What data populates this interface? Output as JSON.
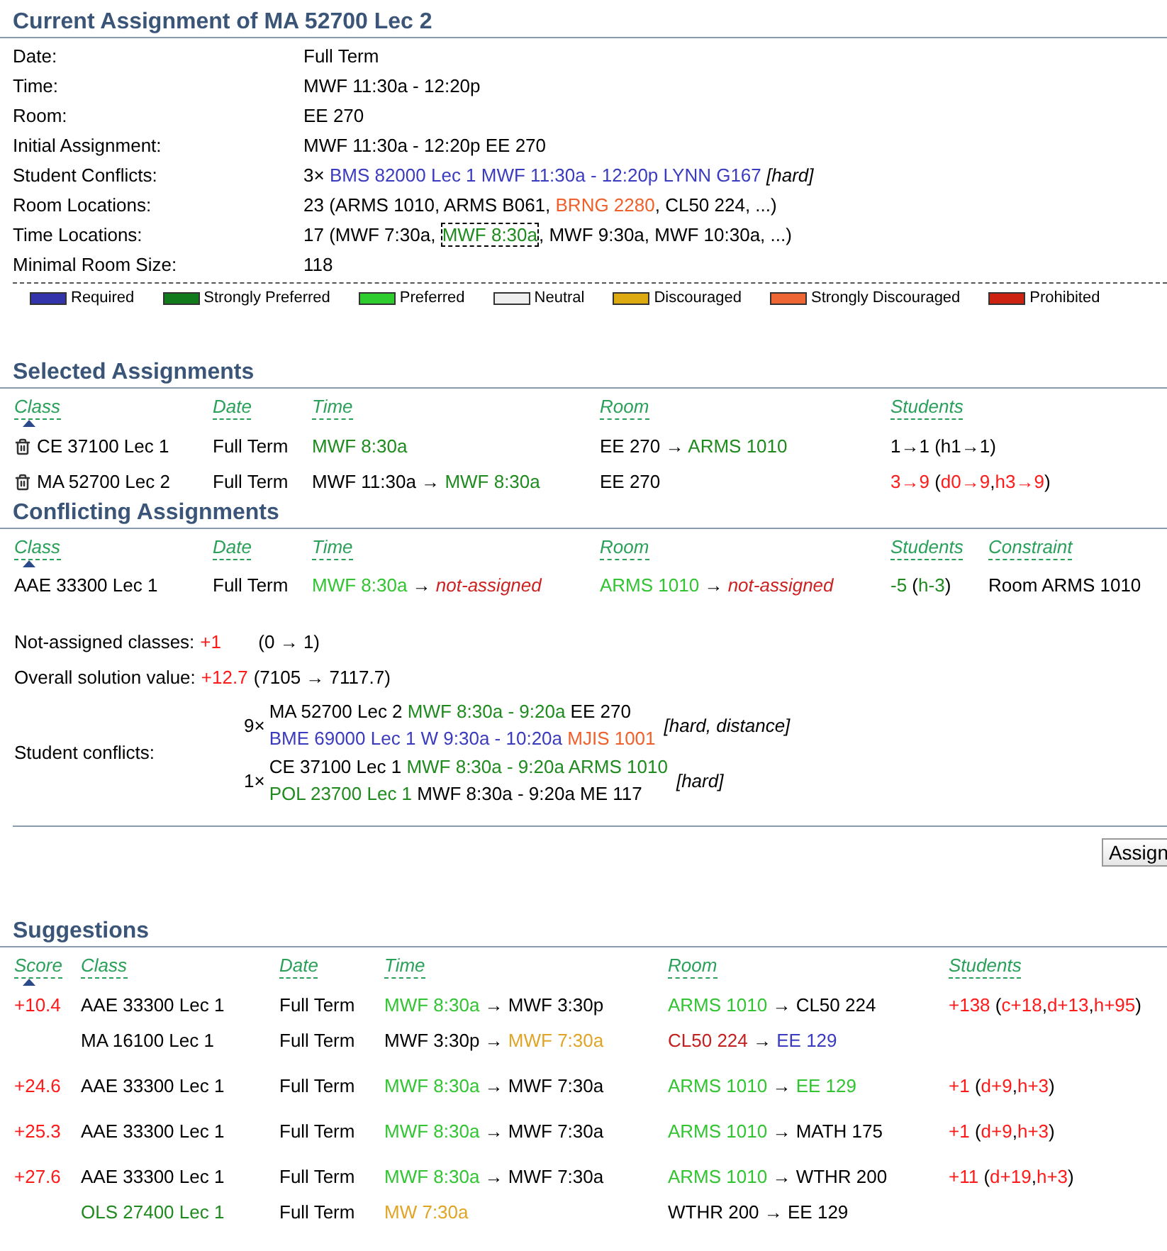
{
  "current": {
    "title": "Current Assignment of MA 52700 Lec 2",
    "rows": [
      {
        "label": "Date:",
        "value": [
          {
            "text": "Full Term"
          }
        ]
      },
      {
        "label": "Time:",
        "value": [
          {
            "text": "MWF 11:30a - 12:20p"
          }
        ]
      },
      {
        "label": "Room:",
        "value": [
          {
            "text": "EE 270"
          }
        ]
      },
      {
        "label": "Initial Assignment:",
        "value": [
          {
            "text": "MWF 11:30a - 12:20p EE 270"
          }
        ]
      },
      {
        "label": "Student Conflicts:",
        "value": [
          {
            "text": "3× "
          },
          {
            "text": "BMS 82000 Lec 1 MWF 11:30a - 12:20p LYNN G167",
            "color": "#3b3bbf"
          },
          {
            "text": " [hard]",
            "italic": true
          }
        ]
      },
      {
        "label": "Room Locations:",
        "value": [
          {
            "text": "23 (ARMS 1010, ARMS B061, "
          },
          {
            "text": "BRNG 2280",
            "color": "#f0602a"
          },
          {
            "text": ", CL50 224, ...)"
          }
        ]
      },
      {
        "label": "Time Locations:",
        "value": [
          {
            "text": "17 (MWF 7:30a, "
          },
          {
            "text": "MWF 8:30a",
            "color": "#1f8b1f",
            "outlined": true
          },
          {
            "text": ", MWF 9:30a, MWF 10:30a, ...)"
          }
        ]
      },
      {
        "label": "Minimal Room Size:",
        "value": [
          {
            "text": "118"
          }
        ]
      }
    ]
  },
  "legend": [
    {
      "label": "Required",
      "color": "#3333aa"
    },
    {
      "label": "Strongly Preferred",
      "color": "#117a1a"
    },
    {
      "label": "Preferred",
      "color": "#2ecc2e"
    },
    {
      "label": "Neutral",
      "color": "#eeeeee"
    },
    {
      "label": "Discouraged",
      "color": "#ddaa11"
    },
    {
      "label": "Strongly Discouraged",
      "color": "#ee6633"
    },
    {
      "label": "Prohibited",
      "color": "#cc2211"
    }
  ],
  "selected": {
    "title": "Selected Assignments",
    "columns": [
      {
        "label": "Class",
        "sorted": true
      },
      {
        "label": "Date",
        "sorted": false
      },
      {
        "label": "Time",
        "sorted": false
      },
      {
        "label": "Room",
        "sorted": false
      },
      {
        "label": "Students",
        "sorted": false
      }
    ],
    "rows": [
      {
        "class": "CE 37100 Lec 1",
        "date": "Full Term",
        "time": [
          {
            "text": "MWF 8:30a",
            "color": "#1f8b1f"
          }
        ],
        "room": [
          {
            "text": "EE 270 → "
          },
          {
            "text": "ARMS 1010",
            "color": "#1f8b1f"
          }
        ],
        "students": [
          {
            "text": "1→1 (h1→1)"
          }
        ]
      },
      {
        "class": "MA 52700 Lec 2",
        "date": "Full Term",
        "time": [
          {
            "text": "MWF 11:30a → "
          },
          {
            "text": "MWF 8:30a",
            "color": "#1f8b1f"
          }
        ],
        "room": [
          {
            "text": "EE 270"
          }
        ],
        "students": [
          {
            "text": "3→9",
            "color": "#ff1a1a"
          },
          {
            "text": " ("
          },
          {
            "text": "d0→9",
            "color": "#ff1a1a"
          },
          {
            "text": ","
          },
          {
            "text": "h3→9",
            "color": "#ff1a1a"
          },
          {
            "text": ")"
          }
        ]
      }
    ]
  },
  "conflicting": {
    "title": "Conflicting Assignments",
    "columns": [
      {
        "label": "Class",
        "sorted": true
      },
      {
        "label": "Date",
        "sorted": false
      },
      {
        "label": "Time",
        "sorted": false
      },
      {
        "label": "Room",
        "sorted": false
      },
      {
        "label": "Students",
        "sorted": false
      },
      {
        "label": "Constraint",
        "sorted": false
      }
    ],
    "rows": [
      {
        "class": "AAE 33300 Lec 1",
        "date": "Full Term",
        "time": [
          {
            "text": "MWF 8:30a",
            "color": "#33c433"
          },
          {
            "text": " → "
          },
          {
            "text": "not-assigned",
            "color": "#cc2222",
            "italic": true
          }
        ],
        "room": [
          {
            "text": "ARMS 1010",
            "color": "#33c433"
          },
          {
            "text": " → "
          },
          {
            "text": "not-assigned",
            "color": "#cc2222",
            "italic": true
          }
        ],
        "students": [
          {
            "text": "-5",
            "color": "#1f8b1f"
          },
          {
            "text": " ("
          },
          {
            "text": "h-3",
            "color": "#1f8b1f"
          },
          {
            "text": ")"
          }
        ],
        "constraint": "Room ARMS 1010"
      }
    ]
  },
  "summary": {
    "not_assigned": {
      "label": "Not-assigned classes:",
      "delta": "+1",
      "detail": "(0 → 1)"
    },
    "overall": {
      "label": "Overall solution value:",
      "delta": "+12.7",
      "detail": "(7105 → 7117.7)"
    },
    "conflicts": {
      "label": "Student conflicts:",
      "groups": [
        {
          "count": "9×",
          "lines": [
            [
              {
                "text": "MA 52700 Lec 2 "
              },
              {
                "text": "MWF 8:30a - 9:20a",
                "color": "#1f8b1f"
              },
              {
                "text": " EE 270"
              }
            ],
            [
              {
                "text": "BME 69000 Lec 1 W 9:30a - 10:20a",
                "color": "#3b3bbf"
              },
              {
                "text": " MJIS 1001",
                "color": "#f0602a"
              }
            ]
          ],
          "note": "[hard, distance]"
        },
        {
          "count": "1×",
          "lines": [
            [
              {
                "text": "CE 37100 Lec 1 "
              },
              {
                "text": "MWF 8:30a - 9:20a ARMS 1010",
                "color": "#1f8b1f"
              }
            ],
            [
              {
                "text": "POL 23700 Lec 1",
                "color": "#1f8b1f"
              },
              {
                "text": " MWF 8:30a - 9:20a ME 117"
              }
            ]
          ],
          "note": "[hard]"
        }
      ]
    }
  },
  "assign_button": "Assign",
  "suggestions": {
    "title": "Suggestions",
    "columns": [
      {
        "label": "Score",
        "sorted": true
      },
      {
        "label": "Class",
        "sorted": false
      },
      {
        "label": "Date",
        "sorted": false
      },
      {
        "label": "Time",
        "sorted": false
      },
      {
        "label": "Room",
        "sorted": false
      },
      {
        "label": "Students",
        "sorted": false
      }
    ],
    "rows": [
      {
        "score": "+10.4",
        "students": [
          {
            "text": "+138",
            "color": "#ff1a1a"
          },
          {
            "text": " ("
          },
          {
            "text": "c+18",
            "color": "#ff1a1a"
          },
          {
            "text": ","
          },
          {
            "text": "d+13",
            "color": "#ff1a1a"
          },
          {
            "text": ","
          },
          {
            "text": "h+95",
            "color": "#ff1a1a"
          },
          {
            "text": ")"
          }
        ],
        "assignments": [
          {
            "class": [
              {
                "text": "AAE 33300 Lec 1"
              }
            ],
            "date": "Full Term",
            "time": [
              {
                "text": "MWF 8:30a",
                "color": "#33c433"
              },
              {
                "text": " → MWF 3:30p"
              }
            ],
            "room": [
              {
                "text": "ARMS 1010",
                "color": "#33c433"
              },
              {
                "text": " → CL50 224"
              }
            ]
          },
          {
            "class": [
              {
                "text": "MA 16100 Lec 1"
              }
            ],
            "date": "Full Term",
            "time": [
              {
                "text": "MWF 3:30p → "
              },
              {
                "text": "MWF 7:30a",
                "color": "#e0a526"
              }
            ],
            "room": [
              {
                "text": "CL50 224",
                "color": "#c42020"
              },
              {
                "text": " → "
              },
              {
                "text": "EE 129",
                "color": "#3b3bbf"
              }
            ]
          }
        ]
      },
      {
        "score": "+24.6",
        "students": [
          {
            "text": "+1",
            "color": "#ff1a1a"
          },
          {
            "text": " ("
          },
          {
            "text": "d+9",
            "color": "#ff1a1a"
          },
          {
            "text": ","
          },
          {
            "text": "h+3",
            "color": "#ff1a1a"
          },
          {
            "text": ")"
          }
        ],
        "assignments": [
          {
            "class": [
              {
                "text": "AAE 33300 Lec 1"
              }
            ],
            "date": "Full Term",
            "time": [
              {
                "text": "MWF 8:30a",
                "color": "#33c433"
              },
              {
                "text": " → MWF 7:30a"
              }
            ],
            "room": [
              {
                "text": "ARMS 1010",
                "color": "#33c433"
              },
              {
                "text": " → "
              },
              {
                "text": "EE 129",
                "color": "#33c433"
              }
            ]
          }
        ]
      },
      {
        "score": "+25.3",
        "students": [
          {
            "text": "+1",
            "color": "#ff1a1a"
          },
          {
            "text": " ("
          },
          {
            "text": "d+9",
            "color": "#ff1a1a"
          },
          {
            "text": ","
          },
          {
            "text": "h+3",
            "color": "#ff1a1a"
          },
          {
            "text": ")"
          }
        ],
        "assignments": [
          {
            "class": [
              {
                "text": "AAE 33300 Lec 1"
              }
            ],
            "date": "Full Term",
            "time": [
              {
                "text": "MWF 8:30a",
                "color": "#33c433"
              },
              {
                "text": " → MWF 7:30a"
              }
            ],
            "room": [
              {
                "text": "ARMS 1010",
                "color": "#33c433"
              },
              {
                "text": " → MATH 175"
              }
            ]
          }
        ]
      },
      {
        "score": "+27.6",
        "students": [
          {
            "text": "+11",
            "color": "#ff1a1a"
          },
          {
            "text": " ("
          },
          {
            "text": "d+19",
            "color": "#ff1a1a"
          },
          {
            "text": ","
          },
          {
            "text": "h+3",
            "color": "#ff1a1a"
          },
          {
            "text": ")"
          }
        ],
        "assignments": [
          {
            "class": [
              {
                "text": "AAE 33300 Lec 1"
              }
            ],
            "date": "Full Term",
            "time": [
              {
                "text": "MWF 8:30a",
                "color": "#33c433"
              },
              {
                "text": " → MWF 7:30a"
              }
            ],
            "room": [
              {
                "text": "ARMS 1010",
                "color": "#33c433"
              },
              {
                "text": " → WTHR 200"
              }
            ]
          },
          {
            "class": [
              {
                "text": "OLS 27400 Lec 1",
                "color": "#1f8b1f"
              }
            ],
            "date": "Full Term",
            "time": [
              {
                "text": "MW 7:30a",
                "color": "#e0a526"
              }
            ],
            "room": [
              {
                "text": "WTHR 200 → EE 129"
              }
            ]
          }
        ]
      }
    ]
  }
}
